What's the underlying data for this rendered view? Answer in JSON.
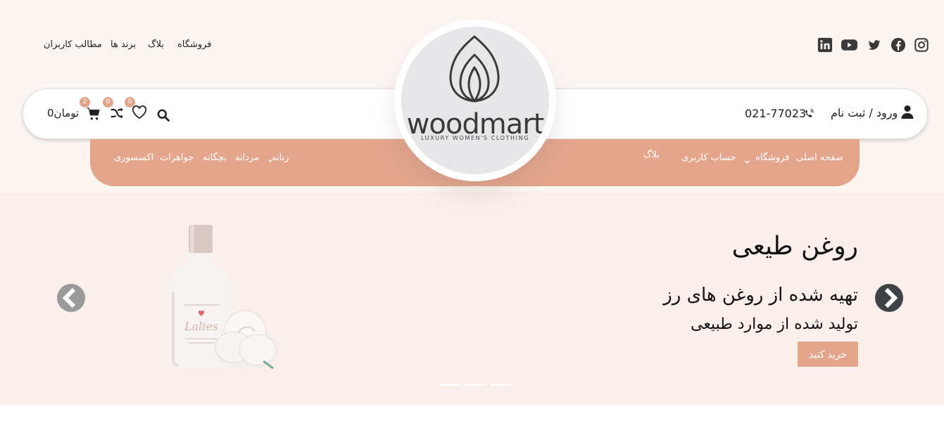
{
  "top_links": [
    "فروشگاه",
    "بلاگ",
    "برند ها",
    "مطالب کاربران"
  ],
  "social_icons": [
    "instagram-icon",
    "facebook-icon",
    "twitter-icon",
    "youtube-icon",
    "linkedin-icon"
  ],
  "header": {
    "login": "ورود / ثبت نام",
    "phone": "021-77023",
    "cart_total": "0تومان",
    "cart_count": "2",
    "compare_count": "0",
    "wishlist_count": "0"
  },
  "logo": {
    "word": "woodmart",
    "tagline": "LUXURY WOMEN'S CLOTHING"
  },
  "nav_right": [
    "صفحه اصلی",
    "فروشگاه",
    "حساب کاربری",
    "بلاگ"
  ],
  "nav_left": [
    "زنانه",
    "مردانه",
    "بچگانه",
    "جواهرات",
    "اکسسوری"
  ],
  "slide": {
    "title": "روغن طیعی",
    "subtitle": "تهیه شده از روغن های رز",
    "subtitle2": "تولید شده از موارد طبیعی",
    "button": "خرید کنید",
    "product_label": "Lalies"
  },
  "colors": {
    "accent": "#e3a58c",
    "top_bg": "#fcf6f3",
    "hero_bg": "#faefeb",
    "icon": "#3a3a3a"
  }
}
